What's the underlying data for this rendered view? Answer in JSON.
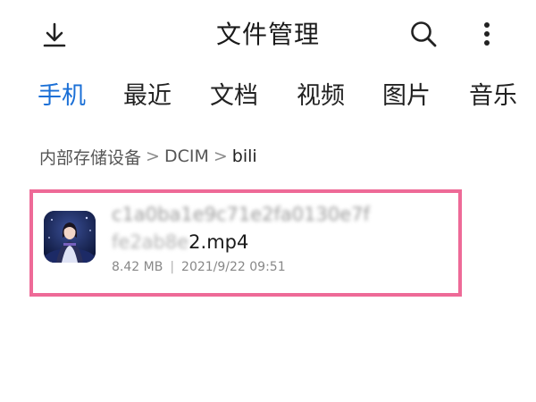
{
  "header": {
    "title": "文件管理",
    "left_icon": "download-icon",
    "right_icons": [
      "search-icon",
      "more-vertical-icon"
    ]
  },
  "tabs": [
    {
      "label": "手机",
      "active": true
    },
    {
      "label": "最近",
      "active": false
    },
    {
      "label": "文档",
      "active": false
    },
    {
      "label": "视频",
      "active": false
    },
    {
      "label": "图片",
      "active": false
    },
    {
      "label": "音乐",
      "active": false
    }
  ],
  "breadcrumb": {
    "items": [
      "内部存储设备",
      "DCIM",
      "bili"
    ],
    "separator": ">"
  },
  "files": [
    {
      "name_line1_obscured": "c1a0ba1e9c71e2fa0130e7f",
      "name_line2_obscured": "fe2ab8e",
      "name_line2_visible": "2.mp4",
      "size": "8.42 MB",
      "meta_divider": "|",
      "modified": "2021/9/22 09:51",
      "thumbnail_icon": "video-thumbnail-icon",
      "highlighted": true
    }
  ],
  "colors": {
    "accent": "#1a6fd6",
    "highlight_border": "#ee6a97",
    "text_primary": "#1a1a1a",
    "text_secondary": "#888888"
  }
}
